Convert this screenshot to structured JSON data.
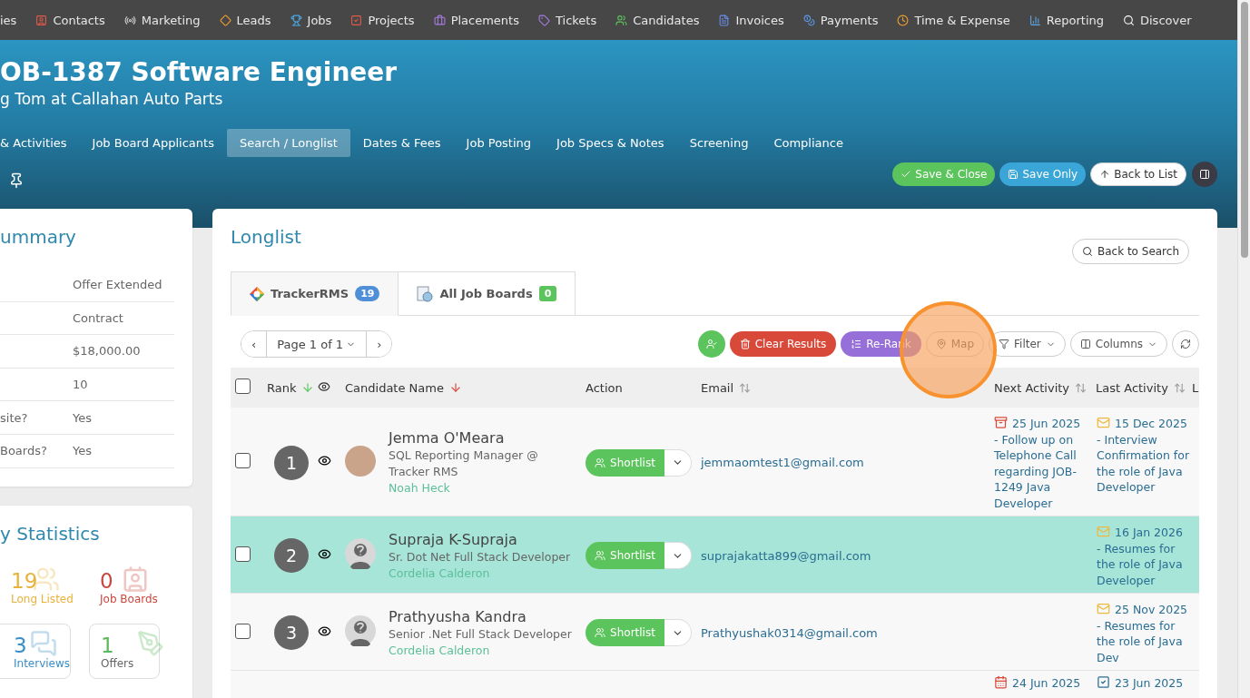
{
  "nav": [
    {
      "label": "ies",
      "kind": "none"
    },
    {
      "label": "Contacts",
      "kind": "contact"
    },
    {
      "label": "Marketing",
      "kind": "antenna"
    },
    {
      "label": "Leads",
      "kind": "diamond"
    },
    {
      "label": "Jobs",
      "kind": "trophy"
    },
    {
      "label": "Projects",
      "kind": "checkbox"
    },
    {
      "label": "Placements",
      "kind": "briefcase"
    },
    {
      "label": "Tickets",
      "kind": "tag"
    },
    {
      "label": "Candidates",
      "kind": "person"
    },
    {
      "label": "Invoices",
      "kind": "document"
    },
    {
      "label": "Payments",
      "kind": "coin"
    },
    {
      "label": "Time & Expense",
      "kind": "clock"
    },
    {
      "label": "Reporting",
      "kind": "chart"
    },
    {
      "label": "Discover",
      "kind": "search"
    }
  ],
  "header": {
    "title": "OB-1387 Software Engineer",
    "subtitle": "g Tom at Callahan Auto Parts"
  },
  "tabs": [
    {
      "label": "& Activities",
      "selected": false
    },
    {
      "label": "Job Board Applicants",
      "selected": false
    },
    {
      "label": "Search / Longlist",
      "selected": true
    },
    {
      "label": "Dates & Fees",
      "selected": false
    },
    {
      "label": "Job Posting",
      "selected": false
    },
    {
      "label": "Job Specs & Notes",
      "selected": false
    },
    {
      "label": "Screening",
      "selected": false
    },
    {
      "label": "Compliance",
      "selected": false
    }
  ],
  "actions": [
    {
      "label": "Save & Close",
      "kind": "save-close"
    },
    {
      "label": "Save Only",
      "kind": "save"
    },
    {
      "label": "Back to List",
      "kind": "back"
    }
  ],
  "summary": {
    "title": "ummary",
    "rows": [
      {
        "label": "",
        "value": "Offer Extended"
      },
      {
        "label": "",
        "value": "Contract"
      },
      {
        "label": "",
        "value": "$18,000.00"
      },
      {
        "label": "",
        "value": "10"
      },
      {
        "label": "site?",
        "value": "Yes"
      },
      {
        "label": "Boards?",
        "value": "Yes"
      }
    ]
  },
  "statistics": {
    "title": "y Statistics",
    "items": [
      {
        "value": "19",
        "label": "Long Listed",
        "color": "#e8b23a",
        "kind": "longlist"
      },
      {
        "value": "0",
        "label": "Job Boards",
        "color": "#c9473c",
        "kind": "jobboards"
      },
      {
        "value": "3",
        "label": "Interviews",
        "color": "#3a8fc9",
        "kind": "interviews"
      },
      {
        "value": "1",
        "label": "Offers",
        "color": "#5cb85c",
        "kind": "offers"
      }
    ]
  },
  "longlist": {
    "title": "Longlist",
    "back_button": "Back to Search",
    "tabs": [
      {
        "label": "TrackerRMS",
        "count": "19",
        "kind": "tracker",
        "selected": true
      },
      {
        "label": "All Job Boards",
        "count": "0",
        "kind": "boards",
        "selected": false
      }
    ],
    "pager": {
      "prev": "‹",
      "page": "Page 1 of 1",
      "next": "›"
    },
    "tools": [
      {
        "kind": "shortlist"
      },
      {
        "kind": "clear",
        "label": "Clear Results"
      },
      {
        "kind": "rerank",
        "label": "Re-Rank"
      },
      {
        "kind": "map",
        "label": "Map"
      },
      {
        "kind": "filter",
        "label": "Filter"
      },
      {
        "kind": "columns",
        "label": "Columns"
      },
      {
        "kind": "refresh"
      }
    ],
    "select_all": {
      "checked": false
    },
    "columns": {
      "rank": "Rank",
      "name": "Candidate Name",
      "action": "Action",
      "email": "Email",
      "next": "Next Activity",
      "last": "Last Activity",
      "column_8": "L"
    },
    "rows": [
      {
        "selected": false,
        "checked": false,
        "kind": "photo",
        "rank": "1",
        "name": "Jemma O'Meara",
        "title": "SQL Reporting Manager @ Tracker RMS",
        "owner": "Noah Heck",
        "action": "Shortlist",
        "email": "jemmaomtest1@gmail.com",
        "next": {
          "kind": "task",
          "date": "25 Jun 2025",
          "text": "- Follow up on Telephone Call regarding JOB-1249 Java Developer"
        },
        "last": {
          "kind": "email",
          "date": "15 Dec 2025",
          "text": "- Interview Confirmation for the role of Java Developer"
        }
      },
      {
        "selected": true,
        "checked": false,
        "kind": "silhouette",
        "rank": "2",
        "name": "Supraja K-Supraja",
        "title": "Sr. Dot Net Full Stack Developer",
        "owner": "Cordelia Calderon",
        "action": "Shortlist",
        "email": "suprajakatta899@gmail.com",
        "last": {
          "kind": "email",
          "date": "16 Jan 2026",
          "text": "- Resumes for the role of Java Developer"
        }
      },
      {
        "selected": false,
        "checked": false,
        "kind": "silhouette",
        "rank": "3",
        "name": "Prathyusha Kandra",
        "title": "Senior .Net Full Stack Developer",
        "owner": "Cordelia Calderon",
        "action": "Shortlist",
        "email": "Prathyushak0314@gmail.com",
        "last": {
          "kind": "email",
          "date": "25 Nov 2025",
          "text": "- Resumes for the role of Java Dev"
        }
      },
      {
        "selected": false,
        "kind": "continuation",
        "next": {
          "kind": "calendar",
          "date": "24 Jun 2025"
        },
        "last": {
          "kind": "check",
          "date": "23 Jun 2025"
        }
      }
    ]
  }
}
